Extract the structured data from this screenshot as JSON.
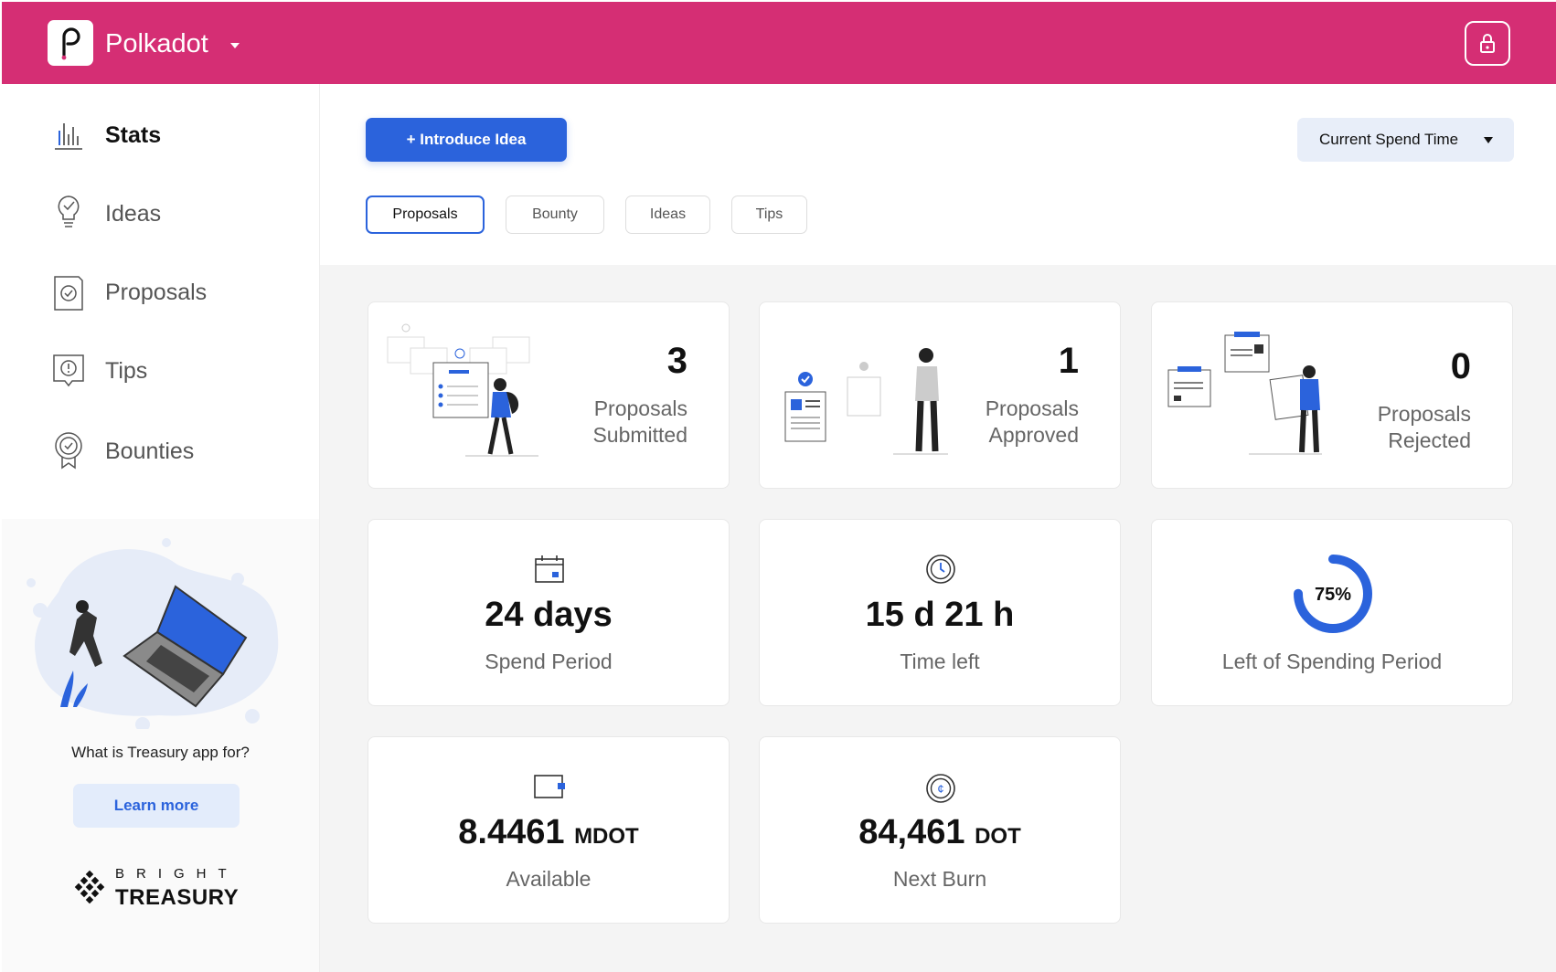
{
  "header": {
    "app_name": "Polkadot",
    "logo_icon": "polkadot-logo-icon",
    "lock_icon": "lock-icon",
    "accent": "#d52e74"
  },
  "sidebar": {
    "items": [
      {
        "label": "Stats",
        "icon": "bar-chart-icon",
        "active": true
      },
      {
        "label": "Ideas",
        "icon": "lightbulb-icon",
        "active": false
      },
      {
        "label": "Proposals",
        "icon": "proposal-check-icon",
        "active": false
      },
      {
        "label": "Tips",
        "icon": "tip-alert-icon",
        "active": false
      },
      {
        "label": "Bounties",
        "icon": "badge-icon",
        "active": false
      }
    ],
    "promo_text": "What is Treasury app for?",
    "learn_more": "Learn more",
    "brand_top": "BRIGHT",
    "brand_bottom": "TREASURY"
  },
  "toolbar": {
    "introduce_idea": "+ Introduce Idea",
    "spend_time": "Current Spend Time",
    "primary_color": "#2b63dc"
  },
  "tabs": [
    "Proposals",
    "Bounty",
    "Ideas",
    "Tips"
  ],
  "active_tab": "Proposals",
  "proposals": [
    {
      "count": "3",
      "label_line1": "Proposals",
      "label_line2": "Submitted"
    },
    {
      "count": "1",
      "label_line1": "Proposals",
      "label_line2": "Approved"
    },
    {
      "count": "0",
      "label_line1": "Proposals",
      "label_line2": "Rejected"
    }
  ],
  "stats": {
    "spend_period": {
      "value": "24 days",
      "label": "Spend Period",
      "icon": "calendar-icon"
    },
    "time_left": {
      "value": "15 d 21 h",
      "label": "Time left",
      "icon": "clock-icon"
    },
    "left_of_period": {
      "percent": 75,
      "percent_text": "75%",
      "label": "Left of Spending Period"
    },
    "available": {
      "value": "8.4461",
      "unit": "MDOT",
      "label": "Available",
      "icon": "wallet-icon"
    },
    "next_burn": {
      "value": "84,461",
      "unit": "DOT",
      "label": "Next Burn",
      "icon": "coin-icon"
    }
  }
}
